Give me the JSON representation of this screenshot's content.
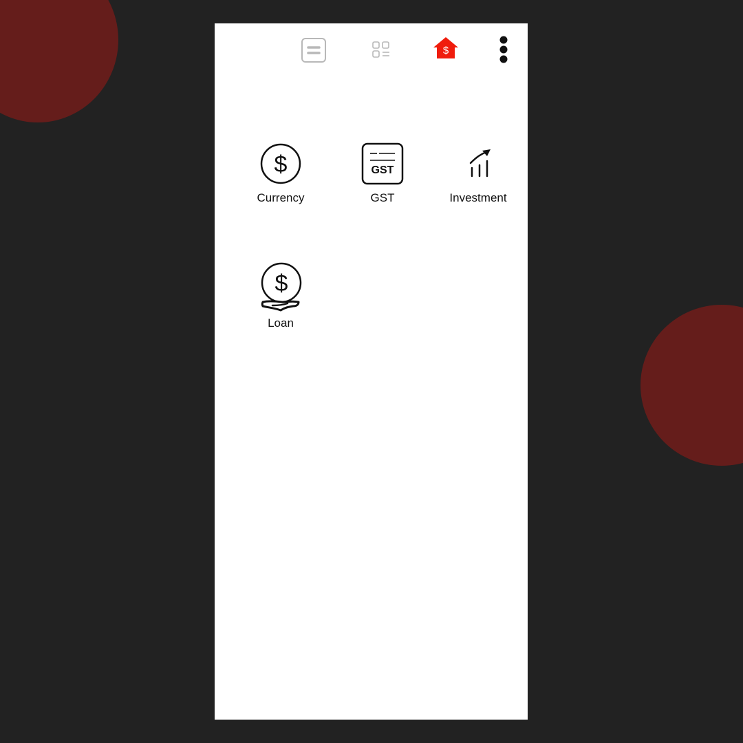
{
  "theme": {
    "background": "#222222",
    "blob_color": "#651d1b",
    "accent": "#f01c0c",
    "panel": "#ffffff",
    "icon_muted": "#b8b8b8",
    "icon_dark": "#111111"
  },
  "toolbar": {
    "list_view_icon": "list-view-icon",
    "grid_view_icon": "grid-view-icon",
    "home_icon": "dollar-home-icon",
    "home_symbol": "$",
    "more_icon": "more-vertical-icon"
  },
  "tiles": [
    {
      "label": "Currency",
      "icon": "currency-dollar-icon"
    },
    {
      "label": "GST",
      "icon": "gst-invoice-icon",
      "icon_text": "GST"
    },
    {
      "label": "Investment",
      "icon": "growth-chart-icon"
    },
    {
      "label": "Loan",
      "icon": "loan-hand-coin-icon"
    }
  ]
}
